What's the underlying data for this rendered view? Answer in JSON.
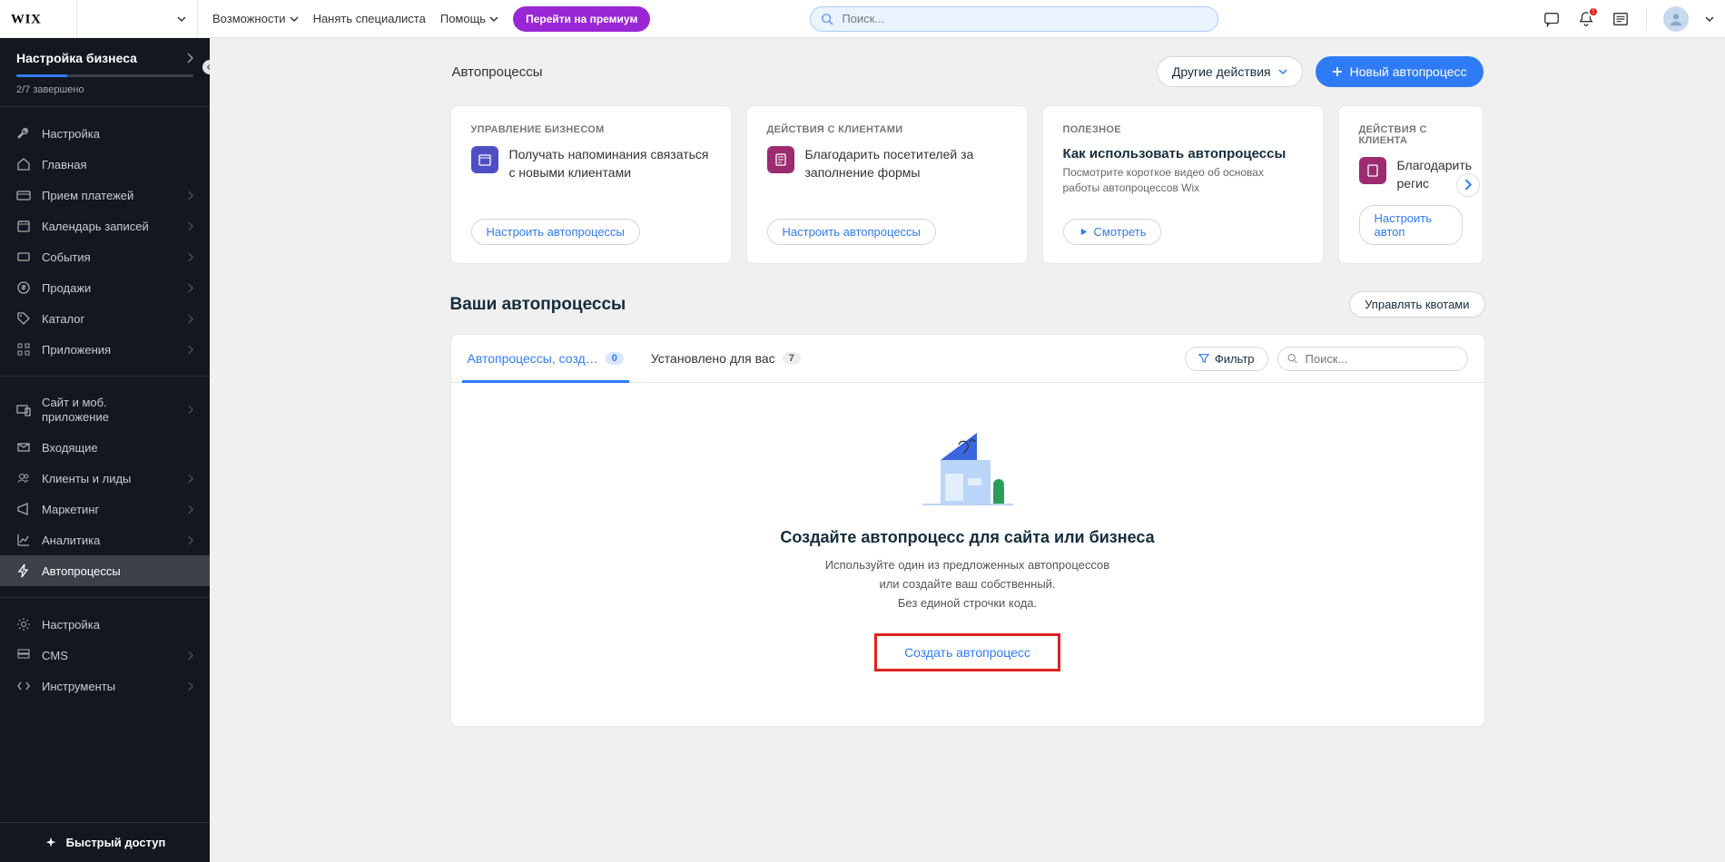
{
  "topbar": {
    "site_name": "",
    "nav": {
      "features": "Возможности",
      "hire": "Нанять специалиста",
      "help": "Помощь"
    },
    "premium": "Перейти на премиум",
    "search_placeholder": "Поиск..."
  },
  "sidebar": {
    "setup": {
      "title": "Настройка бизнеса",
      "progress": "2/7 завершено"
    },
    "items": {
      "setup2": "Настройка",
      "home": "Главная",
      "payments": "Прием платежей",
      "calendar": "Календарь записей",
      "events": "События",
      "sales": "Продажи",
      "catalog": "Каталог",
      "apps": "Приложения",
      "site_app": "Сайт и моб. приложение",
      "inbox": "Входящие",
      "clients": "Клиенты и лиды",
      "marketing": "Маркетинг",
      "analytics": "Аналитика",
      "automations": "Автопроцессы",
      "settings": "Настройка",
      "cms": "CMS",
      "devtools": "Инструменты"
    },
    "quick": "Быстрый доступ"
  },
  "page": {
    "title": "Автопроцессы",
    "other_actions": "Другие действия",
    "new_automation": "Новый автопроцесс"
  },
  "cards": [
    {
      "eyebrow": "УПРАВЛЕНИЕ БИЗНЕСОМ",
      "text": "Получать напоминания связаться с новыми клиентами",
      "action": "Настроить автопроцессы",
      "icon_bg": "ci-blue"
    },
    {
      "eyebrow": "ДЕЙСТВИЯ С КЛИЕНТАМИ",
      "text": "Благодарить посетителей за заполнение формы",
      "action": "Настроить автопроцессы",
      "icon_bg": "ci-pink"
    },
    {
      "eyebrow": "ПОЛЕЗНОЕ",
      "title": "Как использовать автопроцессы",
      "desc": "Посмотрите короткое видео об основах работы автопроцессов Wix",
      "action": "Смотреть",
      "video": true
    },
    {
      "eyebrow": "ДЕЙСТВИЯ С КЛИЕНТА",
      "text": "Благодарить регис",
      "action": "Настроить автоп",
      "icon_bg": "ci-pink"
    }
  ],
  "section": {
    "title": "Ваши автопроцессы",
    "manage": "Управлять квотами"
  },
  "tabs": {
    "created": "Автопроцессы, созд…",
    "created_count": "0",
    "for_you": "Установлено для вас",
    "for_you_count": "7",
    "filter": "Фильтр",
    "search_placeholder": "Поиск..."
  },
  "empty": {
    "title": "Создайте автопроцесс для сайта или бизнеса",
    "line1": "Используйте один из предложенных автопроцессов",
    "line2": "или создайте ваш собственный.",
    "line3": "Без единой строчки кода.",
    "cta": "Создать автопроцесс"
  }
}
